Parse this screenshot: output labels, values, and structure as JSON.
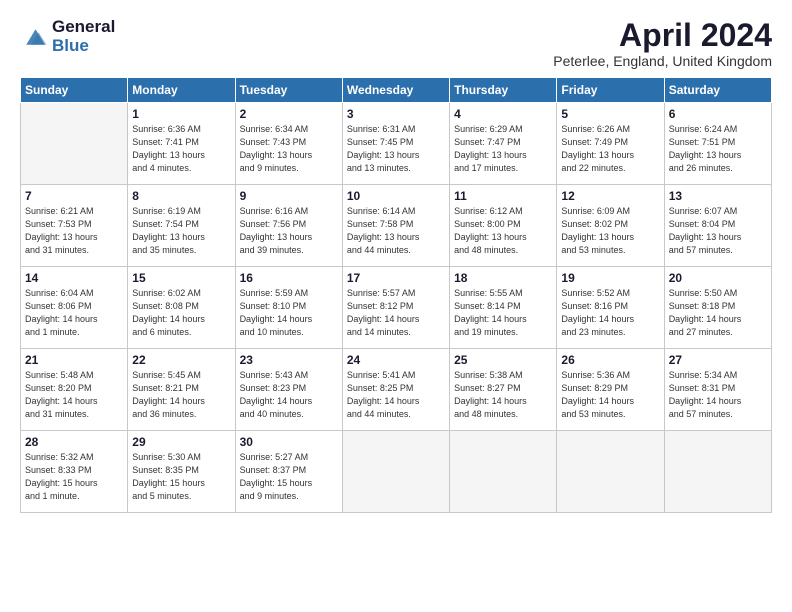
{
  "header": {
    "logo_general": "General",
    "logo_blue": "Blue",
    "title": "April 2024",
    "subtitle": "Peterlee, England, United Kingdom"
  },
  "calendar": {
    "columns": [
      "Sunday",
      "Monday",
      "Tuesday",
      "Wednesday",
      "Thursday",
      "Friday",
      "Saturday"
    ],
    "weeks": [
      [
        {
          "day": "",
          "info": ""
        },
        {
          "day": "1",
          "info": "Sunrise: 6:36 AM\nSunset: 7:41 PM\nDaylight: 13 hours\nand 4 minutes."
        },
        {
          "day": "2",
          "info": "Sunrise: 6:34 AM\nSunset: 7:43 PM\nDaylight: 13 hours\nand 9 minutes."
        },
        {
          "day": "3",
          "info": "Sunrise: 6:31 AM\nSunset: 7:45 PM\nDaylight: 13 hours\nand 13 minutes."
        },
        {
          "day": "4",
          "info": "Sunrise: 6:29 AM\nSunset: 7:47 PM\nDaylight: 13 hours\nand 17 minutes."
        },
        {
          "day": "5",
          "info": "Sunrise: 6:26 AM\nSunset: 7:49 PM\nDaylight: 13 hours\nand 22 minutes."
        },
        {
          "day": "6",
          "info": "Sunrise: 6:24 AM\nSunset: 7:51 PM\nDaylight: 13 hours\nand 26 minutes."
        }
      ],
      [
        {
          "day": "7",
          "info": "Sunrise: 6:21 AM\nSunset: 7:53 PM\nDaylight: 13 hours\nand 31 minutes."
        },
        {
          "day": "8",
          "info": "Sunrise: 6:19 AM\nSunset: 7:54 PM\nDaylight: 13 hours\nand 35 minutes."
        },
        {
          "day": "9",
          "info": "Sunrise: 6:16 AM\nSunset: 7:56 PM\nDaylight: 13 hours\nand 39 minutes."
        },
        {
          "day": "10",
          "info": "Sunrise: 6:14 AM\nSunset: 7:58 PM\nDaylight: 13 hours\nand 44 minutes."
        },
        {
          "day": "11",
          "info": "Sunrise: 6:12 AM\nSunset: 8:00 PM\nDaylight: 13 hours\nand 48 minutes."
        },
        {
          "day": "12",
          "info": "Sunrise: 6:09 AM\nSunset: 8:02 PM\nDaylight: 13 hours\nand 53 minutes."
        },
        {
          "day": "13",
          "info": "Sunrise: 6:07 AM\nSunset: 8:04 PM\nDaylight: 13 hours\nand 57 minutes."
        }
      ],
      [
        {
          "day": "14",
          "info": "Sunrise: 6:04 AM\nSunset: 8:06 PM\nDaylight: 14 hours\nand 1 minute."
        },
        {
          "day": "15",
          "info": "Sunrise: 6:02 AM\nSunset: 8:08 PM\nDaylight: 14 hours\nand 6 minutes."
        },
        {
          "day": "16",
          "info": "Sunrise: 5:59 AM\nSunset: 8:10 PM\nDaylight: 14 hours\nand 10 minutes."
        },
        {
          "day": "17",
          "info": "Sunrise: 5:57 AM\nSunset: 8:12 PM\nDaylight: 14 hours\nand 14 minutes."
        },
        {
          "day": "18",
          "info": "Sunrise: 5:55 AM\nSunset: 8:14 PM\nDaylight: 14 hours\nand 19 minutes."
        },
        {
          "day": "19",
          "info": "Sunrise: 5:52 AM\nSunset: 8:16 PM\nDaylight: 14 hours\nand 23 minutes."
        },
        {
          "day": "20",
          "info": "Sunrise: 5:50 AM\nSunset: 8:18 PM\nDaylight: 14 hours\nand 27 minutes."
        }
      ],
      [
        {
          "day": "21",
          "info": "Sunrise: 5:48 AM\nSunset: 8:20 PM\nDaylight: 14 hours\nand 31 minutes."
        },
        {
          "day": "22",
          "info": "Sunrise: 5:45 AM\nSunset: 8:21 PM\nDaylight: 14 hours\nand 36 minutes."
        },
        {
          "day": "23",
          "info": "Sunrise: 5:43 AM\nSunset: 8:23 PM\nDaylight: 14 hours\nand 40 minutes."
        },
        {
          "day": "24",
          "info": "Sunrise: 5:41 AM\nSunset: 8:25 PM\nDaylight: 14 hours\nand 44 minutes."
        },
        {
          "day": "25",
          "info": "Sunrise: 5:38 AM\nSunset: 8:27 PM\nDaylight: 14 hours\nand 48 minutes."
        },
        {
          "day": "26",
          "info": "Sunrise: 5:36 AM\nSunset: 8:29 PM\nDaylight: 14 hours\nand 53 minutes."
        },
        {
          "day": "27",
          "info": "Sunrise: 5:34 AM\nSunset: 8:31 PM\nDaylight: 14 hours\nand 57 minutes."
        }
      ],
      [
        {
          "day": "28",
          "info": "Sunrise: 5:32 AM\nSunset: 8:33 PM\nDaylight: 15 hours\nand 1 minute."
        },
        {
          "day": "29",
          "info": "Sunrise: 5:30 AM\nSunset: 8:35 PM\nDaylight: 15 hours\nand 5 minutes."
        },
        {
          "day": "30",
          "info": "Sunrise: 5:27 AM\nSunset: 8:37 PM\nDaylight: 15 hours\nand 9 minutes."
        },
        {
          "day": "",
          "info": ""
        },
        {
          "day": "",
          "info": ""
        },
        {
          "day": "",
          "info": ""
        },
        {
          "day": "",
          "info": ""
        }
      ]
    ]
  }
}
